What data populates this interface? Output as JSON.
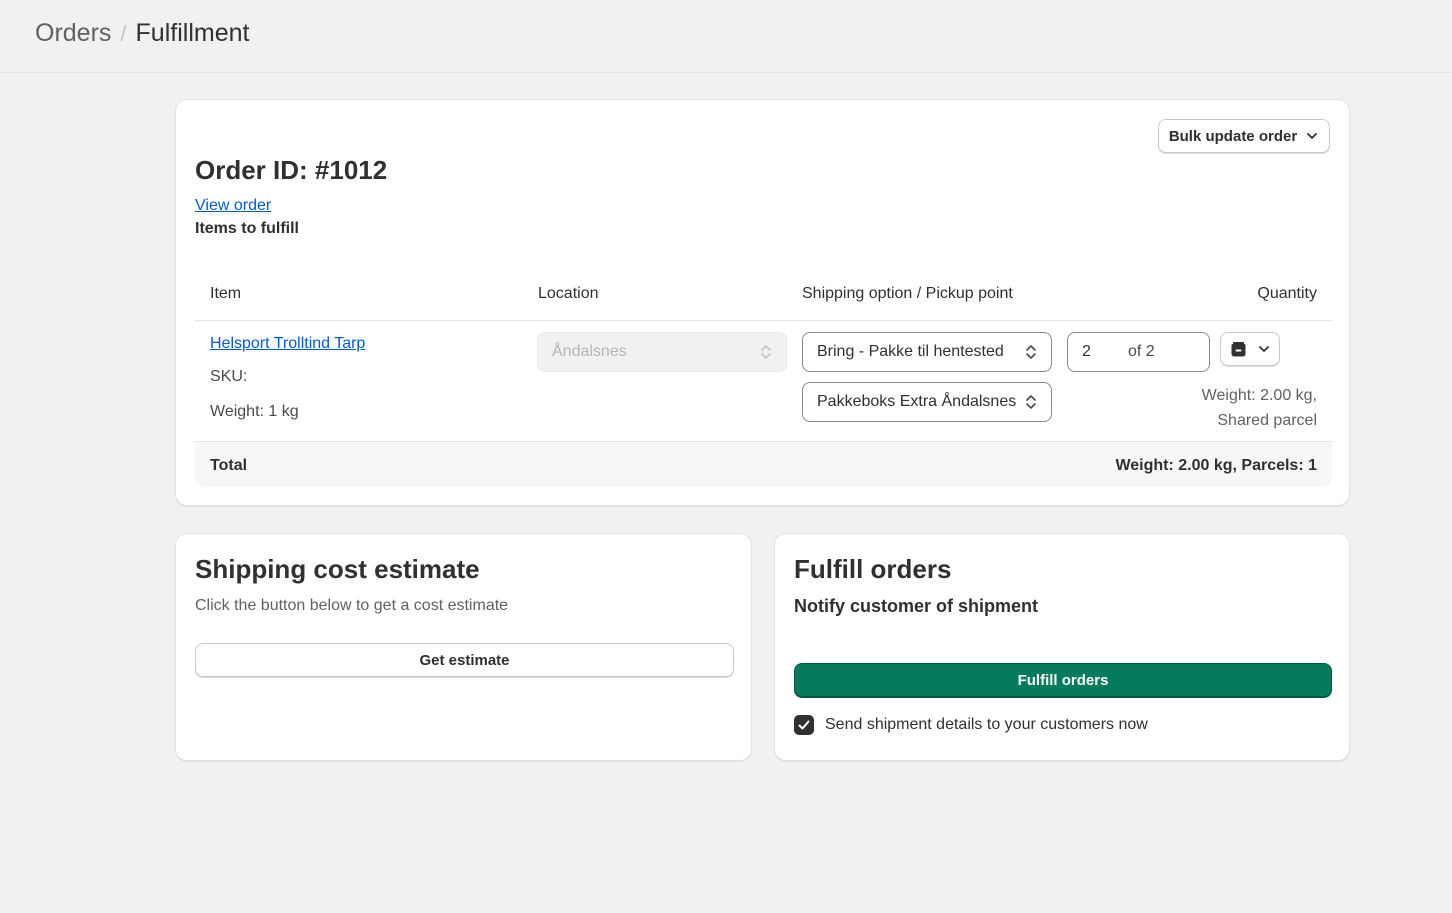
{
  "breadcrumb": {
    "parent": "Orders",
    "separator": "/",
    "current": "Fulfillment"
  },
  "order": {
    "bulk_update_label": "Bulk update order",
    "title": "Order ID: #1012",
    "view_order_label": "View order",
    "items_to_fulfill_label": "Items to fulfill",
    "table": {
      "headers": {
        "item": "Item",
        "location": "Location",
        "shipping": "Shipping option / Pickup point",
        "quantity": "Quantity"
      },
      "rows": [
        {
          "item_name": "Helsport Trolltind Tarp",
          "sku": "SKU:",
          "weight": "Weight: 1 kg",
          "location": "Åndalsnes",
          "shipping_option": "Bring - Pakke til hentested",
          "pickup_point": "Pakkeboks Extra Åndalsnes",
          "quantity_value": "2",
          "quantity_of": "of 2",
          "parcel_weight": "Weight: 2.00 kg,",
          "parcel_type": "Shared parcel"
        }
      ],
      "footer": {
        "label": "Total",
        "value": "Weight: 2.00 kg, Parcels: 1"
      }
    }
  },
  "estimate": {
    "title": "Shipping cost estimate",
    "description": "Click the button below to get a cost estimate",
    "button_label": "Get estimate"
  },
  "fulfill": {
    "title": "Fulfill orders",
    "subtitle": "Notify customer of shipment",
    "button_label": "Fulfill orders",
    "checkbox_label": "Send shipment details to your customers now",
    "checkbox_checked": true
  },
  "colors": {
    "primary_green": "#047b5d",
    "link_blue": "#005bd3",
    "background": "#f1f1f1"
  },
  "icons": {
    "bulk_chevron": "chevron-down-icon",
    "select_arrows": "select-updown-icon",
    "parcel": "package-icon",
    "parcel_chevron": "chevron-down-icon",
    "checkbox": "checkmark-icon"
  }
}
